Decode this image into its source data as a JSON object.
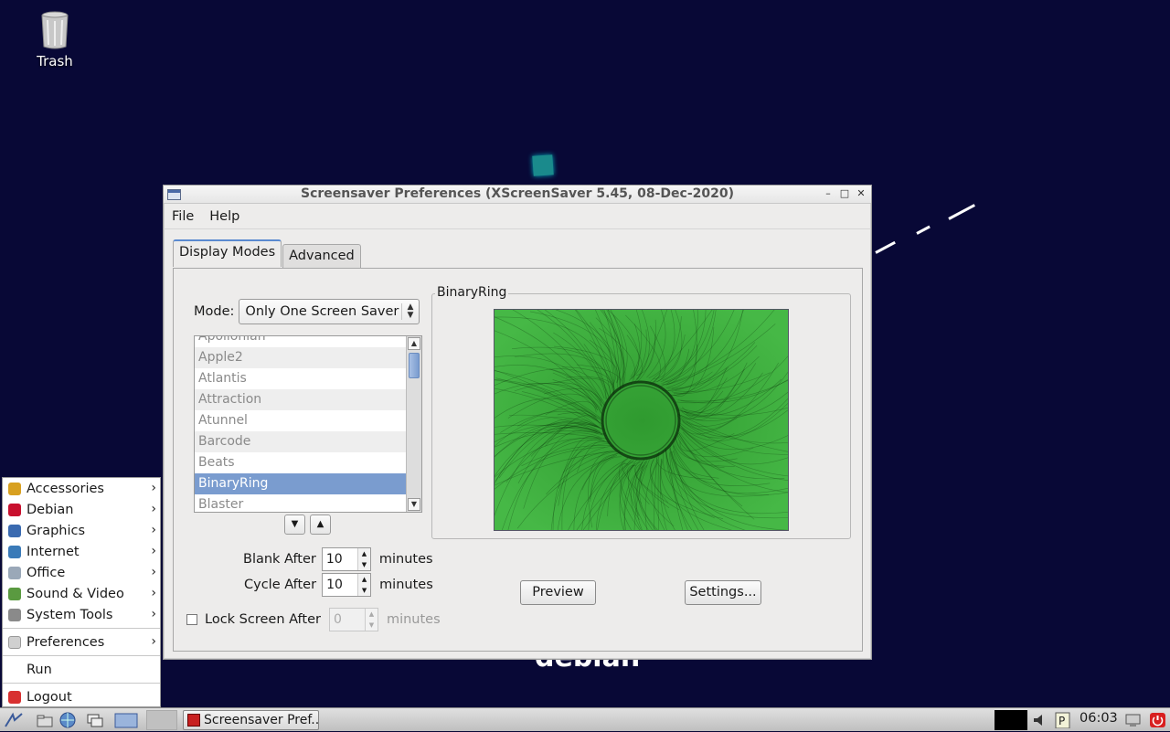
{
  "desktop": {
    "trash_label": "Trash",
    "wm_text": "debian"
  },
  "window": {
    "title": "Screensaver Preferences  (XScreenSaver 5.45, 08-Dec-2020)",
    "menu": {
      "file": "File",
      "help": "Help"
    },
    "tabs": {
      "display_modes": "Display Modes",
      "advanced": "Advanced"
    },
    "mode_label": "Mode:",
    "mode_value": "Only One Screen Saver",
    "savers": [
      "Apollonian",
      "Apple2",
      "Atlantis",
      "Attraction",
      "Atunnel",
      "Barcode",
      "Beats",
      "BinaryRing",
      "Blaster"
    ],
    "selected_saver": "BinaryRing",
    "blank_after_label": "Blank After",
    "blank_after_value": "10",
    "cycle_after_label": "Cycle After",
    "cycle_after_value": "10",
    "lock_label": "Lock Screen After",
    "lock_value": "0",
    "minutes": "minutes",
    "preview_title": "BinaryRing",
    "preview_button": "Preview",
    "settings_button": "Settings..."
  },
  "start_menu": {
    "items": [
      {
        "label": "Accessories",
        "icon": "accessories-icon",
        "color": "#d8a020"
      },
      {
        "label": "Debian",
        "icon": "debian-icon",
        "color": "#c8102e"
      },
      {
        "label": "Graphics",
        "icon": "graphics-icon",
        "color": "#3a6ab0"
      },
      {
        "label": "Internet",
        "icon": "internet-icon",
        "color": "#3a7ab8"
      },
      {
        "label": "Office",
        "icon": "office-icon",
        "color": "#9aa8b8"
      },
      {
        "label": "Sound & Video",
        "icon": "sound-video-icon",
        "color": "#5a9a40"
      },
      {
        "label": "System Tools",
        "icon": "system-tools-icon",
        "color": "#8a8a8a"
      }
    ],
    "preferences": "Preferences",
    "run": "Run",
    "logout": "Logout"
  },
  "taskbar": {
    "task_label": "Screensaver Pref...",
    "clock": "06:03"
  }
}
